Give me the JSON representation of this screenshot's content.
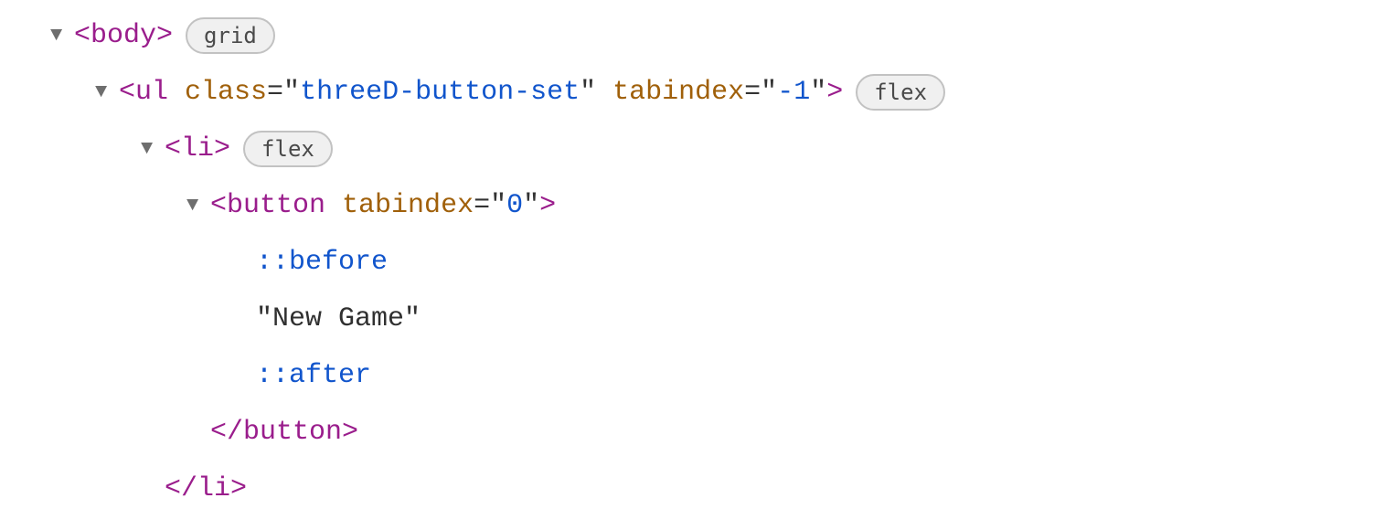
{
  "dom": {
    "rows": [
      {
        "kind": "open",
        "indent": "i0",
        "triangle": true,
        "parts": [
          "<",
          "body",
          ">"
        ],
        "partClasses": [
          "tag",
          "tag",
          "tag"
        ],
        "badge": "grid"
      },
      {
        "kind": "open",
        "indent": "i1",
        "triangle": true,
        "parts": [
          "<",
          "ul ",
          "class",
          "=\"",
          "threeD-button-set",
          "\" ",
          "tabindex",
          "=\"",
          "-1",
          "\"",
          ">"
        ],
        "partClasses": [
          "tag",
          "tag",
          "attr-name",
          "punct",
          "attr-value",
          "punct",
          "attr-name",
          "punct",
          "attr-value",
          "punct",
          "tag"
        ],
        "badge": "flex"
      },
      {
        "kind": "open",
        "indent": "i2",
        "triangle": true,
        "parts": [
          "<",
          "li",
          ">"
        ],
        "partClasses": [
          "tag",
          "tag",
          "tag"
        ],
        "badge": "flex"
      },
      {
        "kind": "open",
        "indent": "i3",
        "triangle": true,
        "parts": [
          "<",
          "button ",
          "tabindex",
          "=\"",
          "0",
          "\"",
          ">"
        ],
        "partClasses": [
          "tag",
          "tag",
          "attr-name",
          "punct",
          "attr-value",
          "punct",
          "tag"
        ],
        "badge": null
      },
      {
        "kind": "pseudo",
        "indent": "i4",
        "triangle": false,
        "parts": [
          "::before"
        ],
        "partClasses": [
          "pseudo"
        ]
      },
      {
        "kind": "text",
        "indent": "i4",
        "triangle": false,
        "parts": [
          "\"New Game\""
        ],
        "partClasses": [
          "text-node"
        ]
      },
      {
        "kind": "pseudo",
        "indent": "i4",
        "triangle": false,
        "parts": [
          "::after"
        ],
        "partClasses": [
          "pseudo"
        ]
      },
      {
        "kind": "close",
        "indent": "i3-close",
        "triangle": false,
        "parts": [
          "</",
          "button",
          ">"
        ],
        "partClasses": [
          "tag",
          "tag",
          "tag"
        ]
      },
      {
        "kind": "close",
        "indent": "i2-close",
        "triangle": false,
        "parts": [
          "</",
          "li",
          ">"
        ],
        "partClasses": [
          "tag",
          "tag",
          "tag"
        ]
      }
    ]
  }
}
